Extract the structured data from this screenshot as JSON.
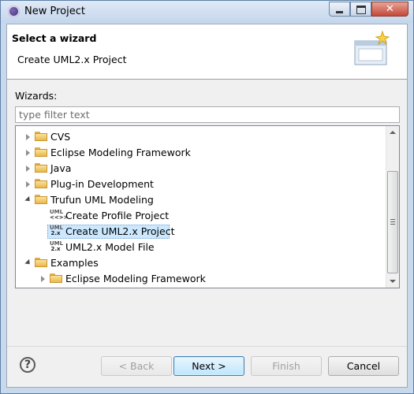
{
  "window": {
    "title": "New Project",
    "close_glyph": "✕"
  },
  "header": {
    "title": "Select a wizard",
    "description": "Create UML2.x Project",
    "banner_icon": "new-wizard-banner-icon"
  },
  "wizards": {
    "label": "Wizards:",
    "filter_placeholder": "type filter text",
    "items": [
      {
        "label": "CVS",
        "icon": "folder-icon",
        "state": "collapsed",
        "level": 0
      },
      {
        "label": "Eclipse Modeling Framework",
        "icon": "folder-icon",
        "state": "collapsed",
        "level": 0
      },
      {
        "label": "Java",
        "icon": "folder-icon",
        "state": "collapsed",
        "level": 0
      },
      {
        "label": "Plug-in Development",
        "icon": "folder-icon",
        "state": "collapsed",
        "level": 0
      },
      {
        "label": "Trufun UML Modeling",
        "icon": "folder-icon",
        "state": "expanded",
        "level": 0
      },
      {
        "label": "Create Profile Project",
        "icon": "uml-profile-icon",
        "level": 1,
        "icon_top": "UML",
        "icon_bottom": "<<>>"
      },
      {
        "label": "Create UML2.x Project",
        "icon": "uml2x-icon",
        "level": 1,
        "selected": true,
        "icon_top": "UML",
        "icon_bottom": "2.x"
      },
      {
        "label": "UML2.x Model File",
        "icon": "uml2x-icon",
        "level": 1,
        "icon_top": "UML",
        "icon_bottom": "2.x"
      },
      {
        "label": "Examples",
        "icon": "folder-icon",
        "state": "expanded",
        "level": 0
      },
      {
        "label": "Eclipse Modeling Framework",
        "icon": "folder-icon",
        "state": "collapsed",
        "level": 1
      }
    ]
  },
  "footer": {
    "help_glyph": "?",
    "back_label": "< Back",
    "next_label": "Next >",
    "finish_label": "Finish",
    "cancel_label": "Cancel"
  },
  "colors": {
    "selection": "#cce8ff",
    "title_bar": "#c9d9ec",
    "default_button": "#bee6fd"
  }
}
